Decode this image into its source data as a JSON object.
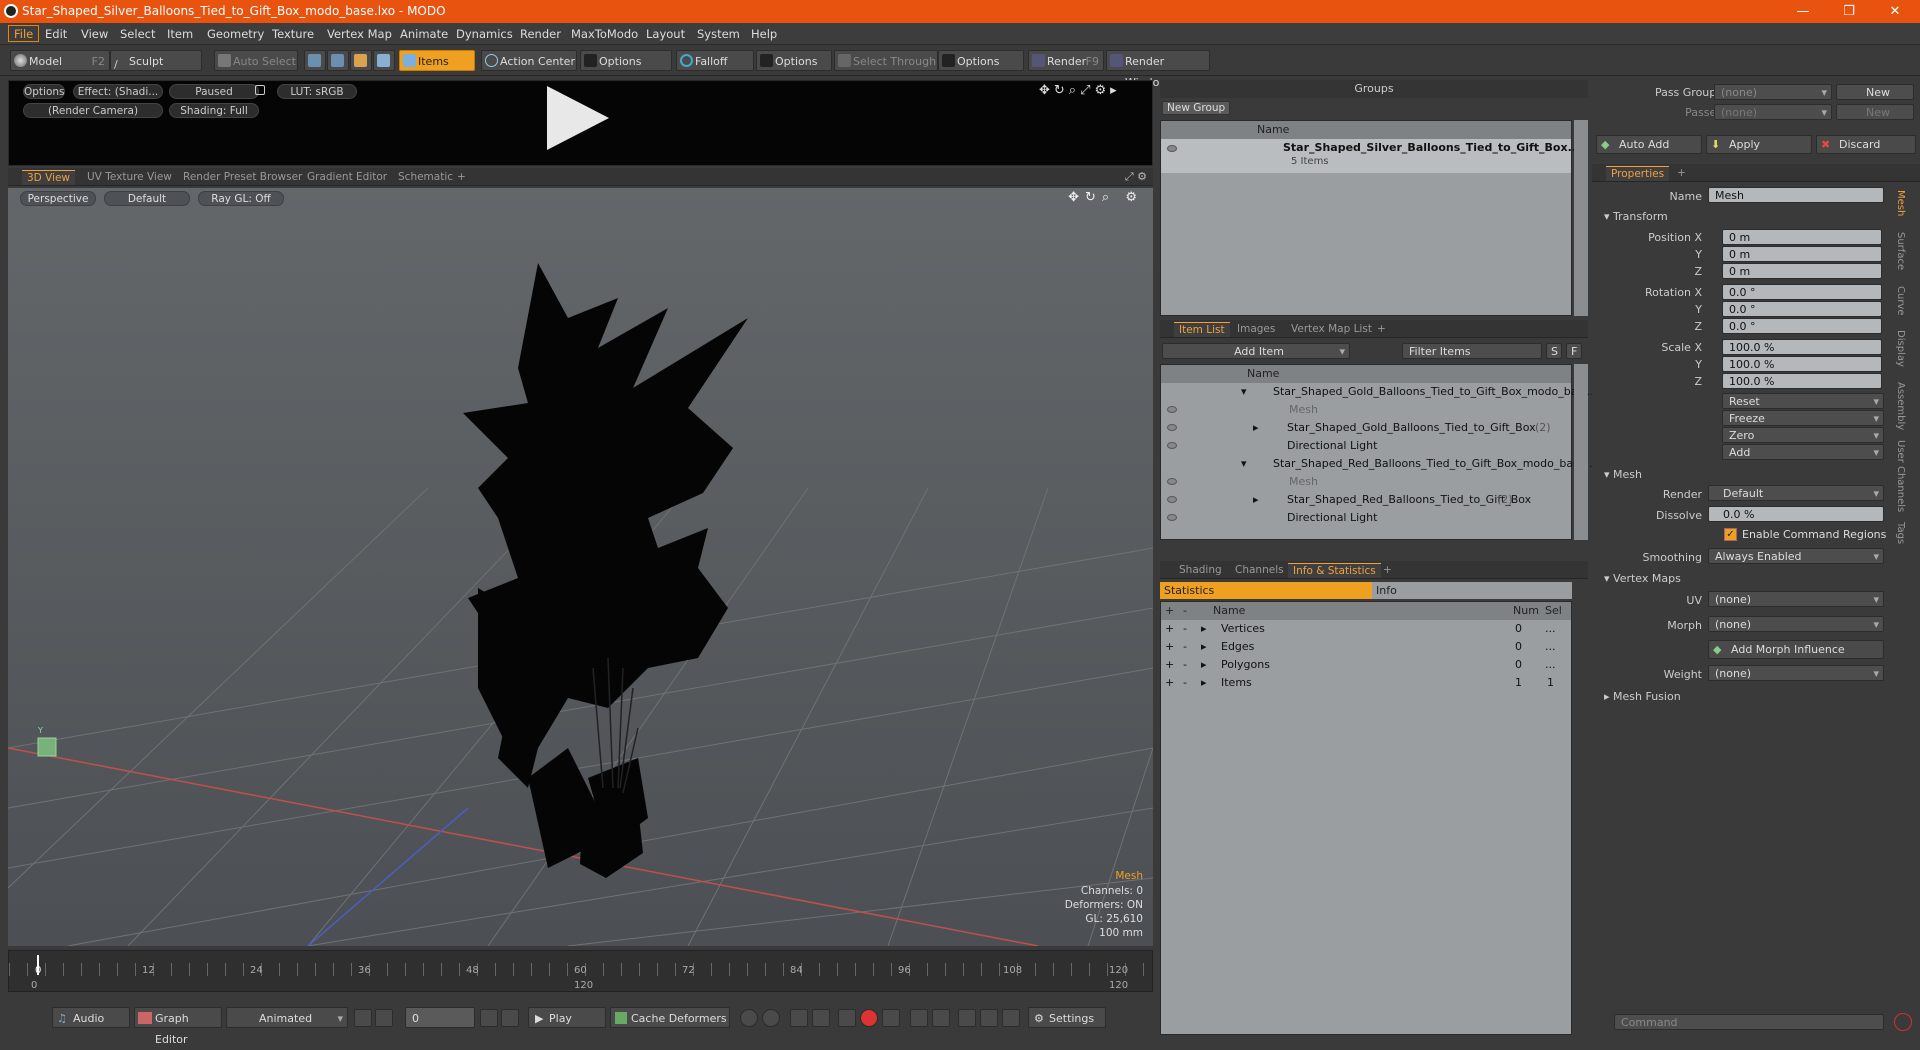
{
  "window": {
    "title": "Star_Shaped_Silver_Balloons_Tied_to_Gift_Box_modo_base.lxo - MODO"
  },
  "menu": [
    "File",
    "Edit",
    "View",
    "Select",
    "Item",
    "Geometry",
    "Texture",
    "Vertex Map",
    "Animate",
    "Dynamics",
    "Render",
    "MaxToModo",
    "Layout",
    "System",
    "Help"
  ],
  "toolbar": {
    "model": "Model",
    "model_key": "F2",
    "sculpt": "Sculpt",
    "auto_select": "Auto Select",
    "items": "Items",
    "action_center": "Action Center",
    "options": "Options",
    "falloff": "Falloff",
    "select_through": "Select Through",
    "render": "Render",
    "render_key": "F9",
    "render_window": "Render Window"
  },
  "preview": {
    "options": "Options",
    "effect": "Effect: (Shadi...",
    "paused": "Paused",
    "lut": "LUT: sRGB",
    "camera": "(Render Camera)",
    "shading": "Shading: Full"
  },
  "viewport_tabs": [
    "3D View",
    "UV Texture View",
    "Render Preset Browser",
    "Gradient Editor",
    "Schematic",
    "+"
  ],
  "viewport": {
    "perspective": "Perspective",
    "default": "Default",
    "raygl": "Ray GL: Off",
    "stats": {
      "title": "Mesh",
      "channels": "Channels: 0",
      "deformers": "Deformers: ON",
      "gl": "GL: 25,610",
      "units": "100 mm"
    }
  },
  "timeline": {
    "ticks_top": [
      "0",
      "12",
      "24",
      "36",
      "48",
      "60",
      "72",
      "84",
      "96",
      "108",
      "120"
    ],
    "ticks_bottom": [
      "0",
      "120",
      "120"
    ]
  },
  "bottombar": {
    "audio": "Audio",
    "graph_editor": "Graph Editor",
    "animated": "Animated",
    "frame": "0",
    "play": "Play",
    "cache": "Cache Deformers",
    "settings": "Settings"
  },
  "groups": {
    "title": "Groups",
    "new_group": "New Group",
    "name_col": "Name",
    "item": "Star_Shaped_Silver_Balloons_Tied_to_Gift_Box...",
    "item_sub": "5 Items"
  },
  "itemlist": {
    "tabs": [
      "Item List",
      "Images",
      "Vertex Map List",
      "+"
    ],
    "add_item": "Add Item",
    "filter": "Filter Items",
    "s": "S",
    "f": "F",
    "name_col": "Name",
    "rows": [
      "Star_Shaped_Gold_Balloons_Tied_to_Gift_Box_modo_bas ...",
      "Mesh",
      "Star_Shaped_Gold_Balloons_Tied_to_Gift_Box",
      "Directional Light",
      "Star_Shaped_Red_Balloons_Tied_to_Gift_Box_modo_base....",
      "Mesh",
      "Star_Shaped_Red_Balloons_Tied_to_Gift_Box",
      "Directional Light"
    ],
    "count_gold": "(2)",
    "count_red": "(2)"
  },
  "info": {
    "tabs": [
      "Shading",
      "Channels",
      "Info & Statistics",
      "+"
    ],
    "statistics": "Statistics",
    "info": "Info",
    "cols": [
      "Name",
      "Num",
      "Sel"
    ],
    "rows": [
      {
        "name": "Vertices",
        "num": "0",
        "sel": "..."
      },
      {
        "name": "Edges",
        "num": "0",
        "sel": "..."
      },
      {
        "name": "Polygons",
        "num": "0",
        "sel": "..."
      },
      {
        "name": "Items",
        "num": "1",
        "sel": "1"
      }
    ]
  },
  "props": {
    "pass_groups": "Pass Groups",
    "passes": "Passes",
    "none": "(none)",
    "new": "New",
    "auto_add": "Auto Add",
    "apply": "Apply",
    "discard": "Discard",
    "tab": "Properties",
    "name_label": "Name",
    "name_value": "Mesh",
    "transform": "Transform",
    "position_x": "Position X",
    "rotation_x": "Rotation X",
    "scale_x": "Scale X",
    "y": "Y",
    "z": "Z",
    "pos_val": "0 m",
    "rot_val": "0.0 °",
    "scale_val": "100.0 %",
    "reset": "Reset",
    "freeze": "Freeze",
    "zero": "Zero",
    "add": "Add",
    "mesh": "Mesh",
    "render": "Render",
    "render_val": "Default",
    "dissolve": "Dissolve",
    "dissolve_val": "0.0 %",
    "enable_cmd": "Enable Command Regions",
    "smoothing": "Smoothing",
    "smoothing_val": "Always Enabled",
    "vertex_maps": "Vertex Maps",
    "uv": "UV",
    "morph": "Morph",
    "add_morph": "Add Morph Influence",
    "weight": "Weight",
    "mesh_fusion": "Mesh Fusion",
    "command": "Command",
    "vtabs": [
      "Mesh",
      "Surface",
      "Curve",
      "Display",
      "Assembly",
      "User Channels",
      "Tags"
    ]
  },
  "colors": {
    "accent": "#f0a020",
    "titlebar": "#e8530f"
  }
}
